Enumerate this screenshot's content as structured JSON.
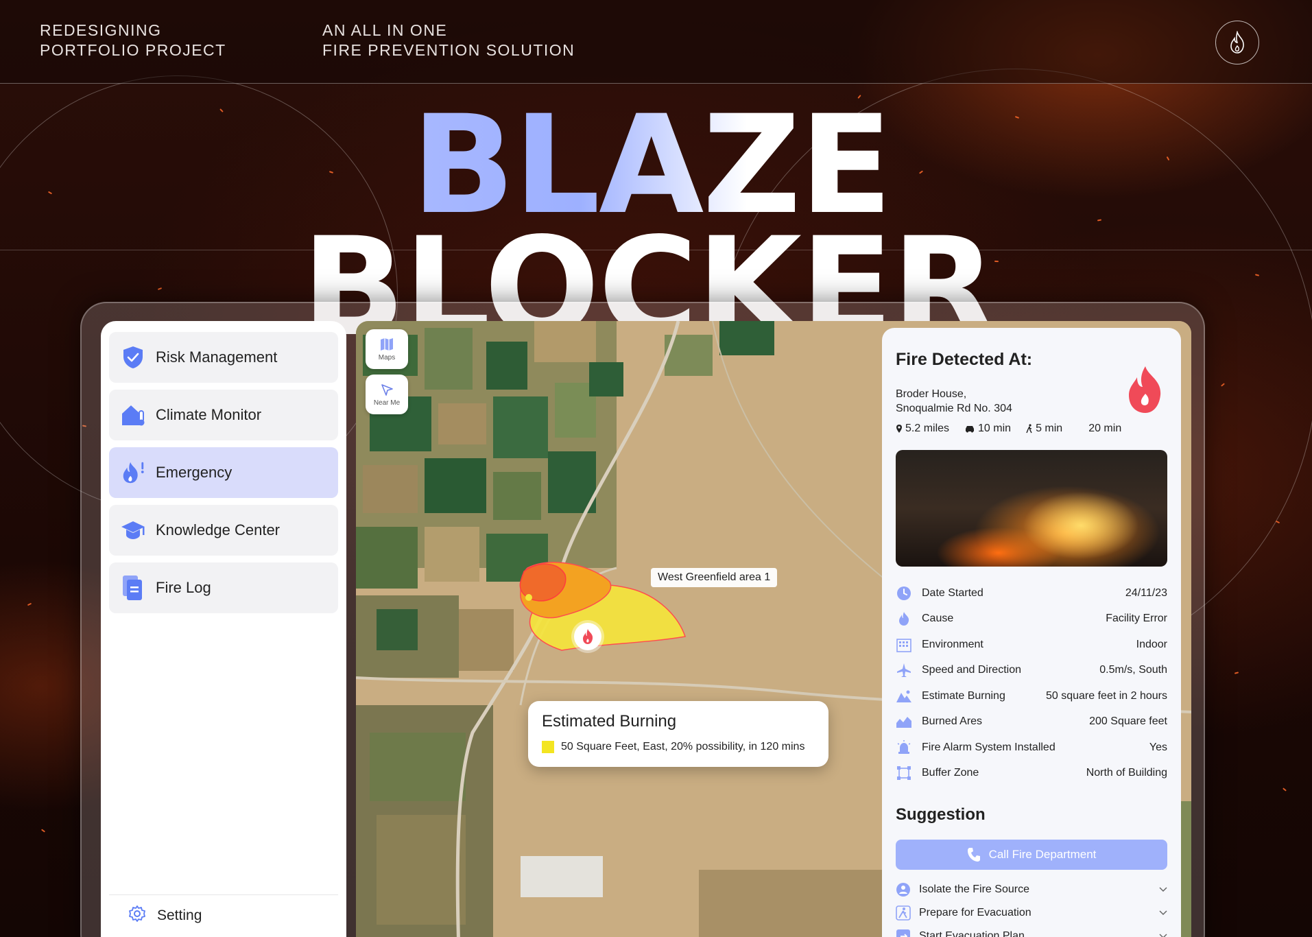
{
  "header": {
    "left_line1": "REDESIGNING",
    "left_line2": "PORTFOLIO PROJECT",
    "mid_line1": "AN ALL IN ONE",
    "mid_line2": "FIRE PREVENTION SOLUTION"
  },
  "hero": {
    "title_line1": "BLAZE",
    "title_line2": "BLOCKER"
  },
  "sidebar": {
    "items": [
      {
        "label": "Risk Management",
        "icon": "shield-check-icon",
        "active": false
      },
      {
        "label": "Climate Monitor",
        "icon": "home-thermometer-icon",
        "active": false
      },
      {
        "label": "Emergency",
        "icon": "fire-alert-icon",
        "active": true
      },
      {
        "label": "Knowledge Center",
        "icon": "graduation-cap-icon",
        "active": false
      },
      {
        "label": "Fire Log",
        "icon": "document-icon",
        "active": false
      }
    ],
    "setting_label": "Setting"
  },
  "map": {
    "maps_label": "Maps",
    "near_me_label": "Near Me",
    "area_label": "West Greenfield area 1",
    "estimate": {
      "title": "Estimated Burning",
      "detail": "50 Square Feet,  East,  20% possibility, in 120 mins",
      "swatch_color": "#f3e521"
    }
  },
  "panel": {
    "title": "Fire Detected At:",
    "address_line1": "Broder House,",
    "address_line2": "Snoqualmie Rd No. 304",
    "distance": "5.2 miles",
    "drive": "10 min",
    "walk": "5 min",
    "other": "20 min",
    "rows": [
      {
        "label": "Date Started",
        "value": "24/11/23",
        "icon": "clock-icon"
      },
      {
        "label": "Cause",
        "value": "Facility Error",
        "icon": "flame-icon"
      },
      {
        "label": "Environment",
        "value": "Indoor",
        "icon": "building-icon"
      },
      {
        "label": "Speed and Direction",
        "value": "0.5m/s, South",
        "icon": "plane-icon"
      },
      {
        "label": "Estimate Burning",
        "value": "50 square feet in 2 hours",
        "icon": "mountain-icon"
      },
      {
        "label": "Burned Ares",
        "value": "200 Square feet",
        "icon": "area-chart-icon"
      },
      {
        "label": "Fire Alarm System Installed",
        "value": "Yes",
        "icon": "alarm-icon"
      },
      {
        "label": "Buffer Zone",
        "value": "North of Building",
        "icon": "buffer-icon"
      }
    ],
    "suggestion_title": "Suggestion",
    "call_button": "Call Fire Department",
    "suggestions": [
      {
        "label": "Isolate the Fire Source",
        "icon": "person-shield-icon"
      },
      {
        "label": "Prepare for Evacuation",
        "icon": "running-person-icon"
      },
      {
        "label": "Start Evacuation Plan",
        "icon": "exit-icon"
      }
    ],
    "accent_color": "#9fb1fb",
    "fire_color": "#f04a58"
  }
}
